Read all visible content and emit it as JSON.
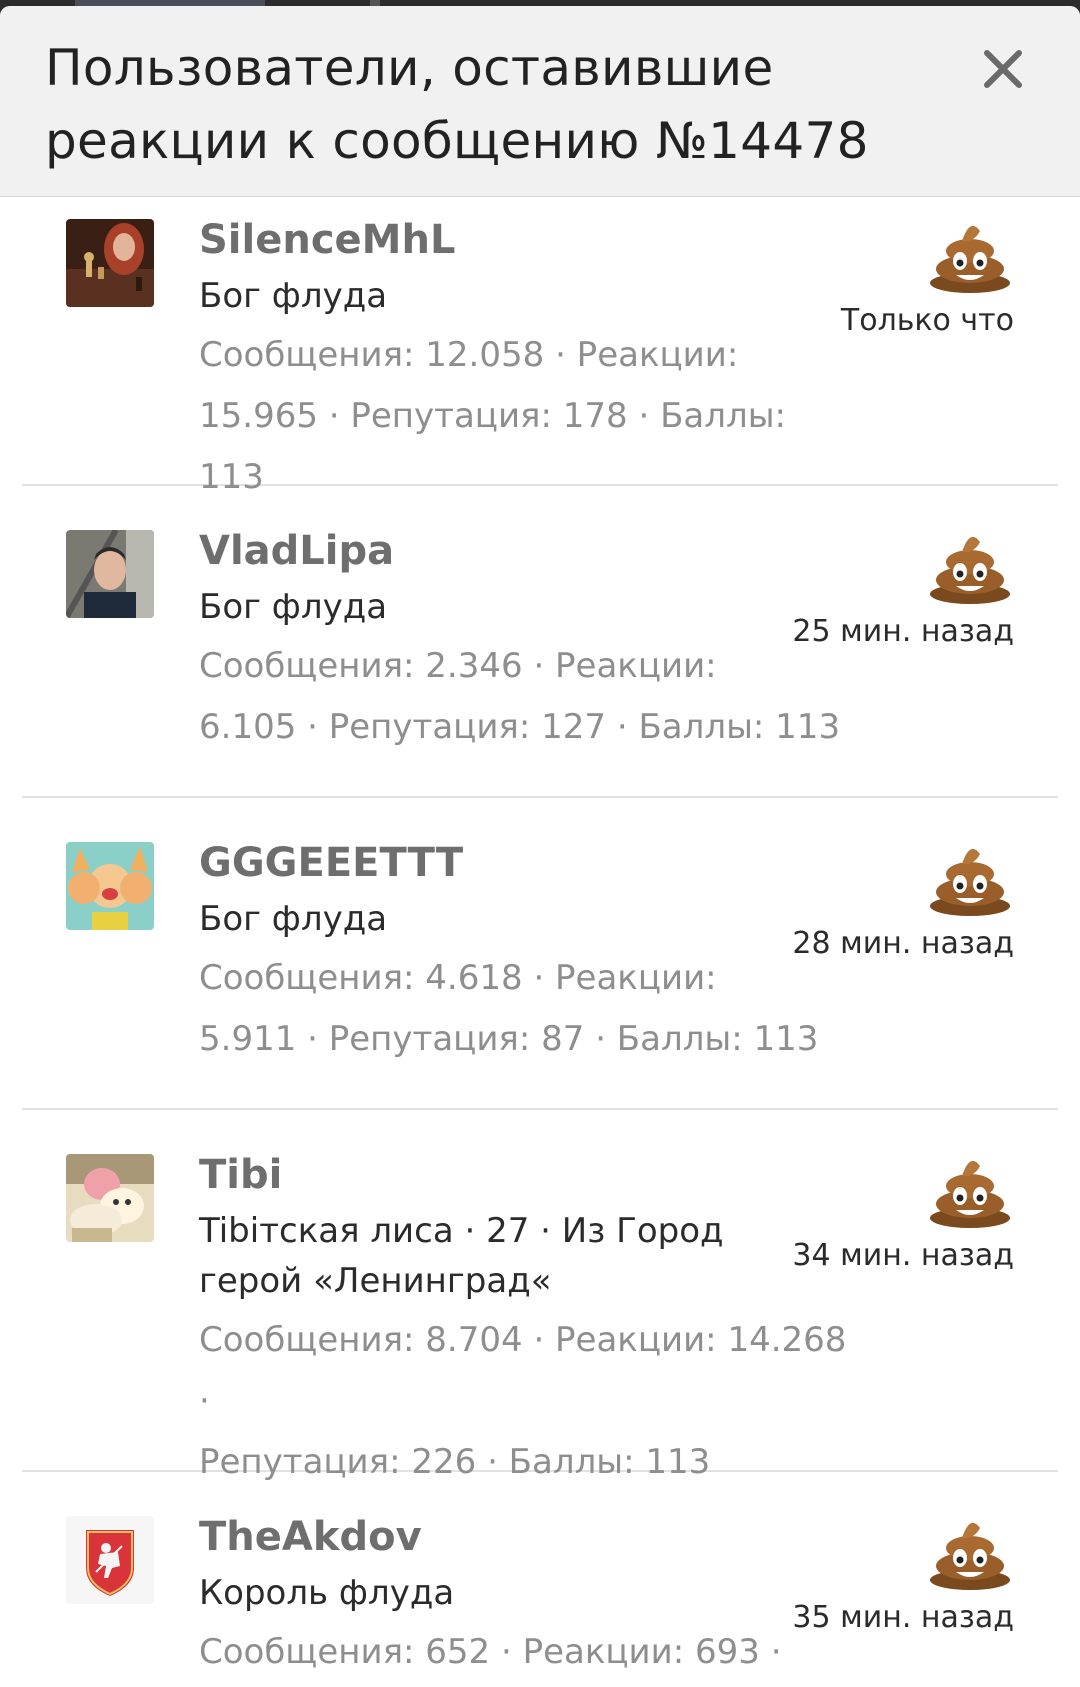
{
  "dialog": {
    "title": "Пользователи, оставившие реакции к сообщению №14478",
    "close_label": "×"
  },
  "users": [
    {
      "username": "SilenceMhL",
      "title": "Бог флуда",
      "stats_line1": "Сообщения: 12.058 · Реакции:",
      "stats_line2": "15.965 · Репутация: 178 · Баллы: 113",
      "reaction_icon": "poop-emoji",
      "time": "Только что"
    },
    {
      "username": "VladLipa",
      "title": "Бог флуда",
      "stats_line1": "Сообщения: 2.346 · Реакции:",
      "stats_line2": "6.105 · Репутация: 127 · Баллы: 113",
      "reaction_icon": "poop-emoji",
      "time": "25 мин. назад"
    },
    {
      "username": "GGGEEETTT",
      "title": "Бог флуда",
      "stats_line1": "Сообщения: 4.618 · Реакции:",
      "stats_line2": "5.911 · Репутация: 87 · Баллы: 113",
      "reaction_icon": "poop-emoji",
      "time": "28 мин. назад"
    },
    {
      "username": "Tibi",
      "title_line1": "Tibiтская лиса · 27 · Из Город",
      "title_line2": "герой «Ленинград«",
      "stats_line1": "Сообщения: 8.704 · Реакции: 14.268 ·",
      "stats_line2": "Репутация: 226 · Баллы: 113",
      "reaction_icon": "poop-emoji",
      "time": "34 мин. назад"
    },
    {
      "username": "TheAkdov",
      "title": "Король флуда",
      "stats_line1": "Сообщения: 652 · Реакции: 693 ·",
      "reaction_icon": "poop-emoji",
      "time": "35 мин. назад"
    }
  ]
}
